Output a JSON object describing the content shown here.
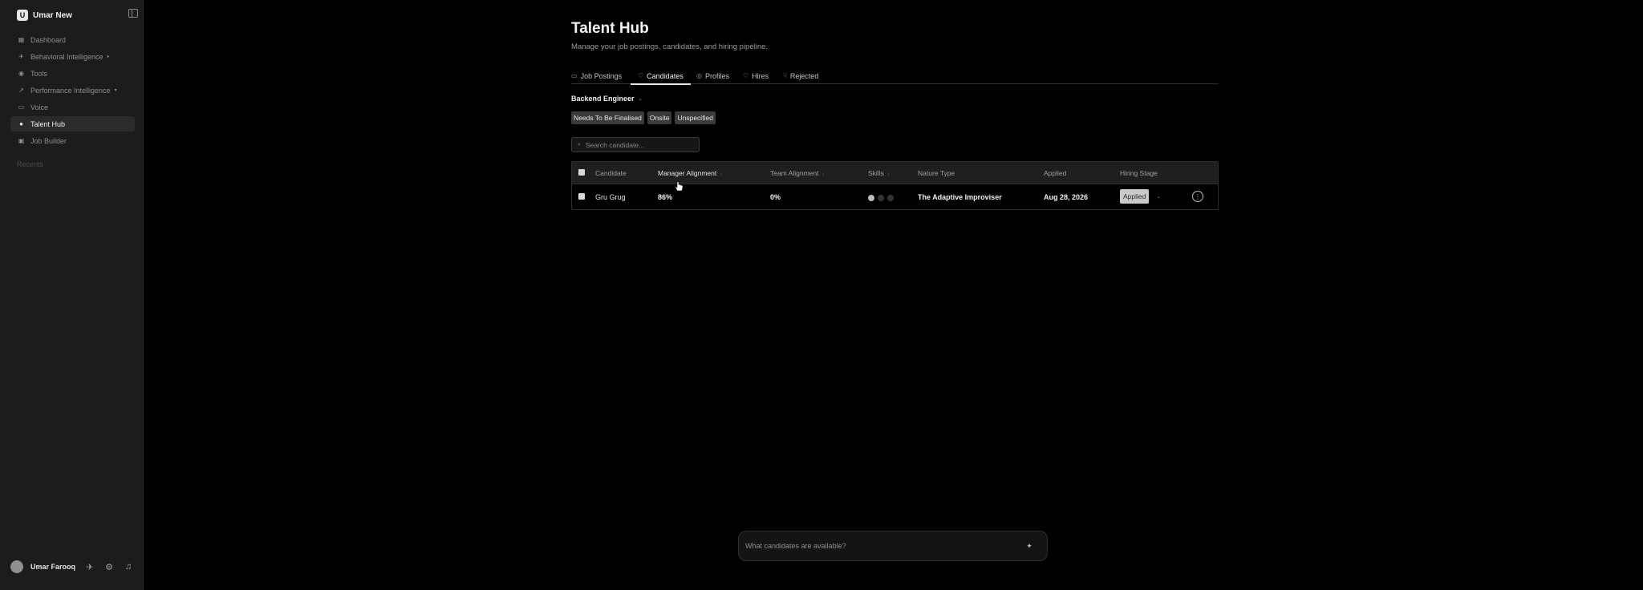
{
  "workspace": {
    "logo": "U",
    "name": "Umar New"
  },
  "sidebar": {
    "items": [
      {
        "label": "Dashboard",
        "icon": "grid-icon",
        "glyph": "▦"
      },
      {
        "label": "Behavioral Intelligence",
        "icon": "rocket-icon",
        "glyph": "✈",
        "caret": "▸"
      },
      {
        "label": "Tools",
        "icon": "tools-icon",
        "glyph": "◉"
      },
      {
        "label": "Performance Intelligence",
        "icon": "trend-icon",
        "glyph": "↗",
        "caret": "▾"
      },
      {
        "label": "Voice",
        "icon": "chat-icon",
        "glyph": "▭"
      },
      {
        "label": "Talent Hub",
        "icon": "user-icon",
        "glyph": "●",
        "active": true
      },
      {
        "label": "Job Builder",
        "icon": "briefcase-icon",
        "glyph": "▣"
      }
    ],
    "recents_label": "Recents",
    "user": {
      "name": "Umar Farooq"
    }
  },
  "page": {
    "title": "Talent Hub",
    "subtitle": "Manage your job postings, candidates, and hiring pipeline."
  },
  "tabs": [
    {
      "label": "Job Postings",
      "icon": "briefcase-icon",
      "glyph": "▭"
    },
    {
      "label": "Candidates",
      "icon": "users-icon",
      "glyph": "♡",
      "active": true
    },
    {
      "label": "Profiles",
      "icon": "profile-icon",
      "glyph": "◎"
    },
    {
      "label": "Hires",
      "icon": "handshake-icon",
      "glyph": "♡"
    },
    {
      "label": "Rejected",
      "icon": "thumbs-down-icon",
      "glyph": "☟"
    }
  ],
  "job_select": {
    "value": "Backend Engineer",
    "caret": "⌄"
  },
  "filters": [
    "Needs To Be Finalised",
    "Onsite",
    "Unspecified"
  ],
  "search": {
    "placeholder": "Search candidate...",
    "icon_glyph": "⌕"
  },
  "table": {
    "columns": {
      "candidate": "Candidate",
      "manager_alignment": "Manager Alignment",
      "team_alignment": "Team Alignment",
      "skills": "Skills",
      "nature_type": "Nature Type",
      "applied": "Applied",
      "hiring_stage": "Hiring Stage"
    },
    "sort_glyph": "↕",
    "rows": [
      {
        "candidate": "Gru Grug",
        "manager_alignment": "86%",
        "team_alignment": "0%",
        "skills_rated": 1,
        "skills_total": 3,
        "nature_type": "The Adaptive Improviser",
        "applied": "Aug 28, 2026",
        "hiring_stage": "Applied"
      }
    ]
  },
  "chat": {
    "placeholder": "What candidates are available?"
  },
  "colors": {
    "background": "#000000",
    "sidebar": "#1c1c1c",
    "accent": "#e6e6e6",
    "chip": "#3a3a3a",
    "stage_badge": "#c9c9c9"
  }
}
